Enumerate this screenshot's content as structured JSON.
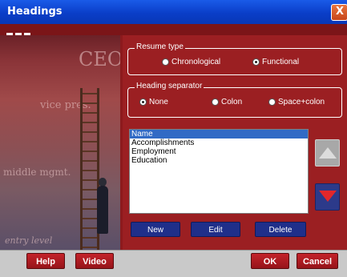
{
  "window": {
    "title": "Headings",
    "close_glyph": "X"
  },
  "resume_type": {
    "legend": "Resume type",
    "options": [
      {
        "label": "Chronological",
        "selected": false
      },
      {
        "label": "Functional",
        "selected": true
      }
    ]
  },
  "heading_separator": {
    "legend": "Heading separator",
    "options": [
      {
        "label": "None",
        "selected": true
      },
      {
        "label": "Colon",
        "selected": false
      },
      {
        "label": "Space+colon",
        "selected": false
      }
    ]
  },
  "headings_list": {
    "items": [
      "Name",
      "Accomplishments",
      "Employment",
      "Education"
    ],
    "selected_index": 0
  },
  "list_actions": {
    "new": "New",
    "edit": "Edit",
    "delete": "Delete"
  },
  "footer": {
    "help": "Help",
    "video": "Video",
    "ok": "OK",
    "cancel": "Cancel"
  },
  "artwork": {
    "words": [
      "CEO",
      "vice pres.",
      "middle mgmt.",
      "entry level"
    ]
  },
  "icons": {
    "move_up": "arrow-up-icon",
    "move_down": "arrow-down-icon"
  },
  "colors": {
    "accent_red": "#9b1f22",
    "title_blue": "#0a3ec8",
    "navy_button": "#1f2f8a",
    "selection": "#316ac5"
  }
}
